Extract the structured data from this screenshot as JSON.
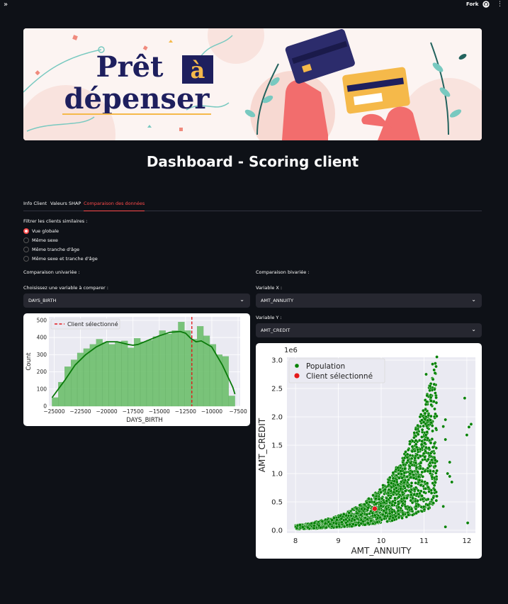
{
  "topbar": {
    "sidebar_toggle": "»",
    "fork_label": "Fork",
    "menu": "⋮"
  },
  "banner": {
    "logo_line1": "Prêt",
    "logo_a": "à",
    "logo_line2": "dépenser"
  },
  "page": {
    "title": "Dashboard - Scoring client"
  },
  "tabs": [
    {
      "label": "Info Client"
    },
    {
      "label": "Valeurs SHAP"
    },
    {
      "label": "Comparaison des données"
    }
  ],
  "filter": {
    "label": "Filtrer les clients similaires :",
    "options": [
      "Vue globale",
      "Même sexe",
      "Même tranche d'âge",
      "Même sexe et tranche d'âge"
    ],
    "selected": "Vue globale"
  },
  "univariate": {
    "heading": "Comparaison univariée :",
    "select_label": "Choisissez une variable à comparer :",
    "select_value": "DAYS_BIRTH"
  },
  "bivariate": {
    "heading": "Comparaison bivariée :",
    "x_label": "Variable X :",
    "x_value": "AMT_ANNUITY",
    "y_label": "Variable Y :",
    "y_value": "AMT_CREDIT"
  },
  "colors": {
    "accent": "#ff4b4b",
    "bg": "#0e1117",
    "widget": "#262730",
    "green": "#008000"
  },
  "chart_data": [
    {
      "type": "bar",
      "xlabel": "DAYS_BIRTH",
      "ylabel": "Count",
      "legend": [
        "Client sélectionné"
      ],
      "legend_position": "top-left",
      "grid": true,
      "xlim": [
        -25500,
        -7300
      ],
      "ylim": [
        0,
        520
      ],
      "x_ticks": [
        -25000,
        -22500,
        -20000,
        -17500,
        -15000,
        -12500,
        -10000,
        -7500
      ],
      "x_tick_labels": [
        "−25000",
        "−22500",
        "−20000",
        "−17500",
        "−15000",
        "−12500",
        "−10000",
        "−7500"
      ],
      "y_ticks": [
        0,
        100,
        200,
        300,
        400,
        500
      ],
      "y_tick_labels": [
        "0",
        "100",
        "200",
        "300",
        "400",
        "500"
      ],
      "bin_edges": [
        -25200,
        -24600,
        -24000,
        -23400,
        -22800,
        -22200,
        -21600,
        -21000,
        -20400,
        -19800,
        -19200,
        -18600,
        -18000,
        -17400,
        -16800,
        -16200,
        -15600,
        -15000,
        -14400,
        -13800,
        -13200,
        -12600,
        -12000,
        -11400,
        -10800,
        -10200,
        -9600,
        -9000,
        -8400,
        -7800
      ],
      "values": [
        50,
        140,
        230,
        270,
        310,
        335,
        360,
        390,
        370,
        360,
        375,
        380,
        340,
        395,
        375,
        385,
        405,
        440,
        420,
        440,
        490,
        440,
        390,
        465,
        410,
        360,
        300,
        290,
        60
      ],
      "kde_x": [
        -25200,
        -24000,
        -23000,
        -22000,
        -21000,
        -20000,
        -19000,
        -18000,
        -17500,
        -17000,
        -16000,
        -15000,
        -14000,
        -13000,
        -12500,
        -12000,
        -11500,
        -11000,
        -10000,
        -9000,
        -8000,
        -7800
      ],
      "kde_y": [
        50,
        150,
        240,
        300,
        345,
        375,
        375,
        360,
        355,
        360,
        385,
        410,
        430,
        435,
        425,
        395,
        375,
        380,
        345,
        240,
        110,
        70
      ],
      "client_value": -11900
    },
    {
      "type": "scatter",
      "xlabel": "AMT_ANNUITY",
      "ylabel": "AMT_CREDIT",
      "y_offset_label": "1e6",
      "legend": [
        "Population",
        "Client sélectionné"
      ],
      "legend_position": "top-left",
      "grid": true,
      "xlim": [
        7.8,
        12.2
      ],
      "ylim": [
        -0.05,
        3.05
      ],
      "x_ticks": [
        8,
        9,
        10,
        11,
        12
      ],
      "y_ticks": [
        0.0,
        0.5,
        1.0,
        1.5,
        2.0,
        2.5,
        3.0
      ],
      "y_tick_labels": [
        "0.0",
        "0.5",
        "1.0",
        "1.5",
        "2.0",
        "2.5",
        "3.0"
      ],
      "client_point": {
        "x": 9.85,
        "y": 0.38
      },
      "outliers": [
        {
          "x": 11.2,
          "y": 2.93
        },
        {
          "x": 11.05,
          "y": 2.75
        },
        {
          "x": 11.95,
          "y": 2.33
        },
        {
          "x": 12.1,
          "y": 1.87
        },
        {
          "x": 12.05,
          "y": 1.82
        },
        {
          "x": 12.0,
          "y": 1.68
        },
        {
          "x": 11.5,
          "y": 1.95
        },
        {
          "x": 11.45,
          "y": 1.83
        },
        {
          "x": 11.5,
          "y": 1.6
        },
        {
          "x": 11.6,
          "y": 1.2
        },
        {
          "x": 11.55,
          "y": 1.0
        },
        {
          "x": 11.6,
          "y": 0.95
        },
        {
          "x": 11.65,
          "y": 0.85
        },
        {
          "x": 11.2,
          "y": 1.75
        },
        {
          "x": 11.1,
          "y": 1.25
        },
        {
          "x": 11.3,
          "y": 1.05
        },
        {
          "x": 12.02,
          "y": 0.13
        },
        {
          "x": 11.5,
          "y": 0.06
        },
        {
          "x": 11.3,
          "y": 0.6
        },
        {
          "x": 11.45,
          "y": 0.42
        }
      ]
    }
  ]
}
